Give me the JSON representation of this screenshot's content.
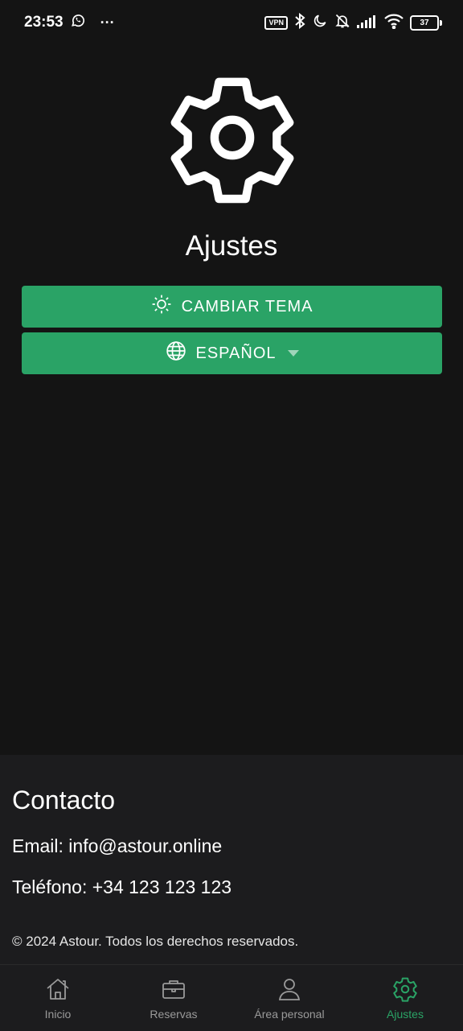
{
  "status_bar": {
    "time": "23:53",
    "more": "···",
    "vpn": "VPN",
    "battery": "37"
  },
  "main": {
    "title": "Ajustes",
    "theme_button_label": "CAMBIAR TEMA",
    "language_button_label": "ESPAÑOL"
  },
  "footer": {
    "title": "Contacto",
    "email": "Email: info@astour.online",
    "phone": "Teléfono: +34 123 123 123",
    "copyright": "© 2024 Astour. Todos los derechos reservados."
  },
  "nav": {
    "items": [
      {
        "label": "Inicio",
        "icon": "home-icon"
      },
      {
        "label": "Reservas",
        "icon": "briefcase-icon"
      },
      {
        "label": "Área personal",
        "icon": "user-icon"
      },
      {
        "label": "Ajustes",
        "icon": "gear-icon"
      }
    ],
    "active_color": "#2aa366"
  },
  "colors": {
    "accent": "#2aa366",
    "background": "#141414",
    "footer_background": "#1c1c1e"
  }
}
